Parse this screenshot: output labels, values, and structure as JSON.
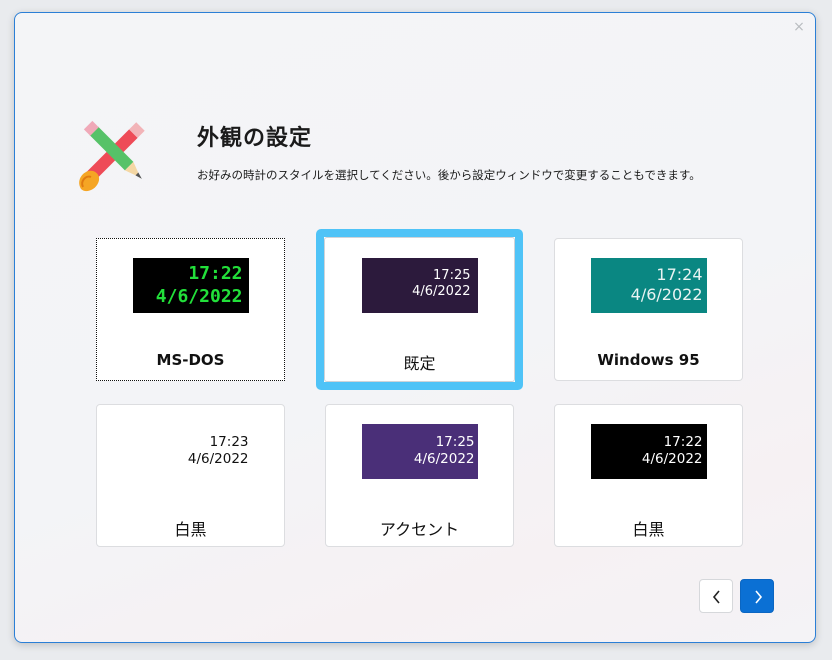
{
  "window": {
    "close_icon": "×"
  },
  "header": {
    "title": "外観の設定",
    "description": "お好みの時計のスタイルを選択してください。後から設定ウィンドウで変更することもできます。",
    "icon": "pencil-brush-icon"
  },
  "styles": [
    {
      "label": "MS-DOS",
      "time": "17:22",
      "date": "4/6/2022",
      "bg": "#000000",
      "fg": "#22e03a",
      "state": "focused"
    },
    {
      "label": "既定",
      "time": "17:25",
      "date": "4/6/2022",
      "bg": "#2c1a3c",
      "fg": "#ffffff",
      "state": "selected"
    },
    {
      "label": "Windows 95",
      "time": "17:24",
      "date": "4/6/2022",
      "bg": "#0a8782",
      "fg": "#e9f4f3",
      "state": "normal"
    },
    {
      "label": "白黒",
      "time": "17:23",
      "date": "4/6/2022",
      "bg": "#ffffff",
      "fg": "#111111",
      "state": "normal"
    },
    {
      "label": "アクセント",
      "time": "17:25",
      "date": "4/6/2022",
      "bg": "#4a2f78",
      "fg": "#ffffff",
      "state": "normal"
    },
    {
      "label": "白黒",
      "time": "17:22",
      "date": "4/6/2022",
      "bg": "#000000",
      "fg": "#ffffff",
      "state": "normal"
    }
  ],
  "navigation": {
    "prev_icon": "chevron-left-icon",
    "next_icon": "chevron-right-icon",
    "accent": "#0b70d4"
  }
}
